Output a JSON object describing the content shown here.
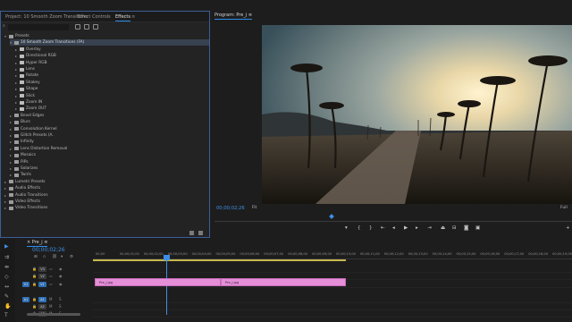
{
  "effects_panel": {
    "tabs": [
      "Project: 10 Smooth Zoom Transitions",
      "Effect Controls",
      "Effects"
    ],
    "active_tab": "Effects",
    "tree": [
      {
        "label": "Presets",
        "level": 0,
        "open": true,
        "kind": "folder"
      },
      {
        "label": "10 Smooth Zoom Transitions (FA)",
        "level": 1,
        "open": true,
        "kind": "folder",
        "selected": true
      },
      {
        "label": "Overlay",
        "level": 2,
        "kind": "preset"
      },
      {
        "label": "Directional RGB",
        "level": 2,
        "kind": "preset"
      },
      {
        "label": "Hyper RGB",
        "level": 2,
        "kind": "preset"
      },
      {
        "label": "Lens",
        "level": 2,
        "kind": "preset"
      },
      {
        "label": "Rotate",
        "level": 2,
        "kind": "preset"
      },
      {
        "label": "Shakey",
        "level": 2,
        "kind": "preset"
      },
      {
        "label": "Shape",
        "level": 2,
        "kind": "preset"
      },
      {
        "label": "Slick",
        "level": 2,
        "kind": "preset"
      },
      {
        "label": "Zoom IN",
        "level": 2,
        "kind": "preset"
      },
      {
        "label": "Zoom OUT",
        "level": 2,
        "kind": "preset"
      },
      {
        "label": "Bevel Edges",
        "level": 1,
        "kind": "folder"
      },
      {
        "label": "Blurs",
        "level": 1,
        "kind": "folder"
      },
      {
        "label": "Convolution Kernel",
        "level": 1,
        "kind": "folder"
      },
      {
        "label": "Glitch Presets (A.",
        "level": 1,
        "kind": "folder"
      },
      {
        "label": "Infinity",
        "level": 1,
        "kind": "folder"
      },
      {
        "label": "Lens Distortion Removal",
        "level": 1,
        "kind": "folder"
      },
      {
        "label": "Mosaics",
        "level": 1,
        "kind": "folder"
      },
      {
        "label": "PiPs",
        "level": 1,
        "kind": "folder"
      },
      {
        "label": "Solarizes",
        "level": 1,
        "kind": "folder"
      },
      {
        "label": "Twirls",
        "level": 1,
        "kind": "folder"
      },
      {
        "label": "Lumetri Presets",
        "level": 0,
        "kind": "folder"
      },
      {
        "label": "Audio Effects",
        "level": 0,
        "kind": "folder"
      },
      {
        "label": "Audio Transitions",
        "level": 0,
        "kind": "folder"
      },
      {
        "label": "Video Effects",
        "level": 0,
        "kind": "folder"
      },
      {
        "label": "Video Transitions",
        "level": 0,
        "kind": "folder"
      }
    ]
  },
  "program_monitor": {
    "tab": "Program: Pre_j",
    "timecode": "00;00;02;26",
    "fit": "Fit",
    "resolution": "Full"
  },
  "timeline": {
    "sequence_tab": "Pre_j",
    "timecode": "00;00;02;26",
    "ruler": [
      "00;00",
      "00;00;01;00",
      "00;00;02;00",
      "00;00;03;00",
      "00;00;04;00",
      "00;00;05;00",
      "00;00;06;00",
      "00;00;07;00",
      "00;00;08;00",
      "00;00;09;00",
      "00;00;10;00",
      "00;00;11;00",
      "00;00;12;00",
      "00;00;13;00",
      "00;00;14;00",
      "00;00;15;00",
      "00;00;16;00",
      "00;00;17;00",
      "00;00;18;00",
      "00;00;19;00"
    ],
    "tracks": [
      {
        "name": "V3",
        "target": ""
      },
      {
        "name": "V2",
        "target": ""
      },
      {
        "name": "V1",
        "target": "V1"
      },
      {
        "name": "A1",
        "target": "A1"
      },
      {
        "name": "A2",
        "target": ""
      },
      {
        "name": "A3",
        "target": ""
      }
    ],
    "clips": [
      {
        "label": "Pre_j.jpg",
        "track": "V1"
      },
      {
        "label": "Pre_j.jpg",
        "track": "V1"
      }
    ]
  },
  "colors": {
    "accent": "#3f8ee5",
    "clip": "#e48fd8",
    "work_area": "#c7b84d"
  }
}
